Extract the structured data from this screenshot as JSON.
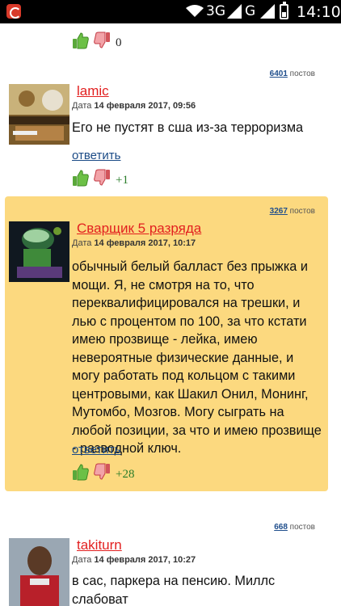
{
  "status": {
    "time": "14:10",
    "network1": "3G",
    "network2": "G"
  },
  "top_votes": {
    "score": "0"
  },
  "posts": [
    {
      "count": "6401",
      "count_suffix": "постов",
      "username": "lamic",
      "date_prefix": "Дата",
      "date": "14 февраля 2017, 09:56",
      "text": "Его не пустят в сша из-за терроризма",
      "reply": "ответить",
      "score": "+1"
    },
    {
      "count": "3267",
      "count_suffix": "постов",
      "username": "Сварщик 5 разряда",
      "date_prefix": "Дата",
      "date": "14 февраля 2017, 10:17",
      "text": "обычный белый балласт без прыжка и мощи. Я, не смотря на то, что переквалифицировался на трешки, и лью с процентом по 100, за что кстати имею прозвище - лейка, имею невероятные физические данные, и могу работать под кольцом с такими центровыми, как Шакил Онил, Монинг, Мутомбо, Мозгов. Могу сыграть на любой позиции, за что и имею прозвище - разводной ключ.",
      "reply": "ответить",
      "score": "+28"
    },
    {
      "count": "668",
      "count_suffix": "постов",
      "username": "takiturn",
      "date_prefix": "Дата",
      "date": "14 февраля 2017, 10:27",
      "text": "в сас, паркера на пенсию. Миллс слабоват"
    }
  ]
}
